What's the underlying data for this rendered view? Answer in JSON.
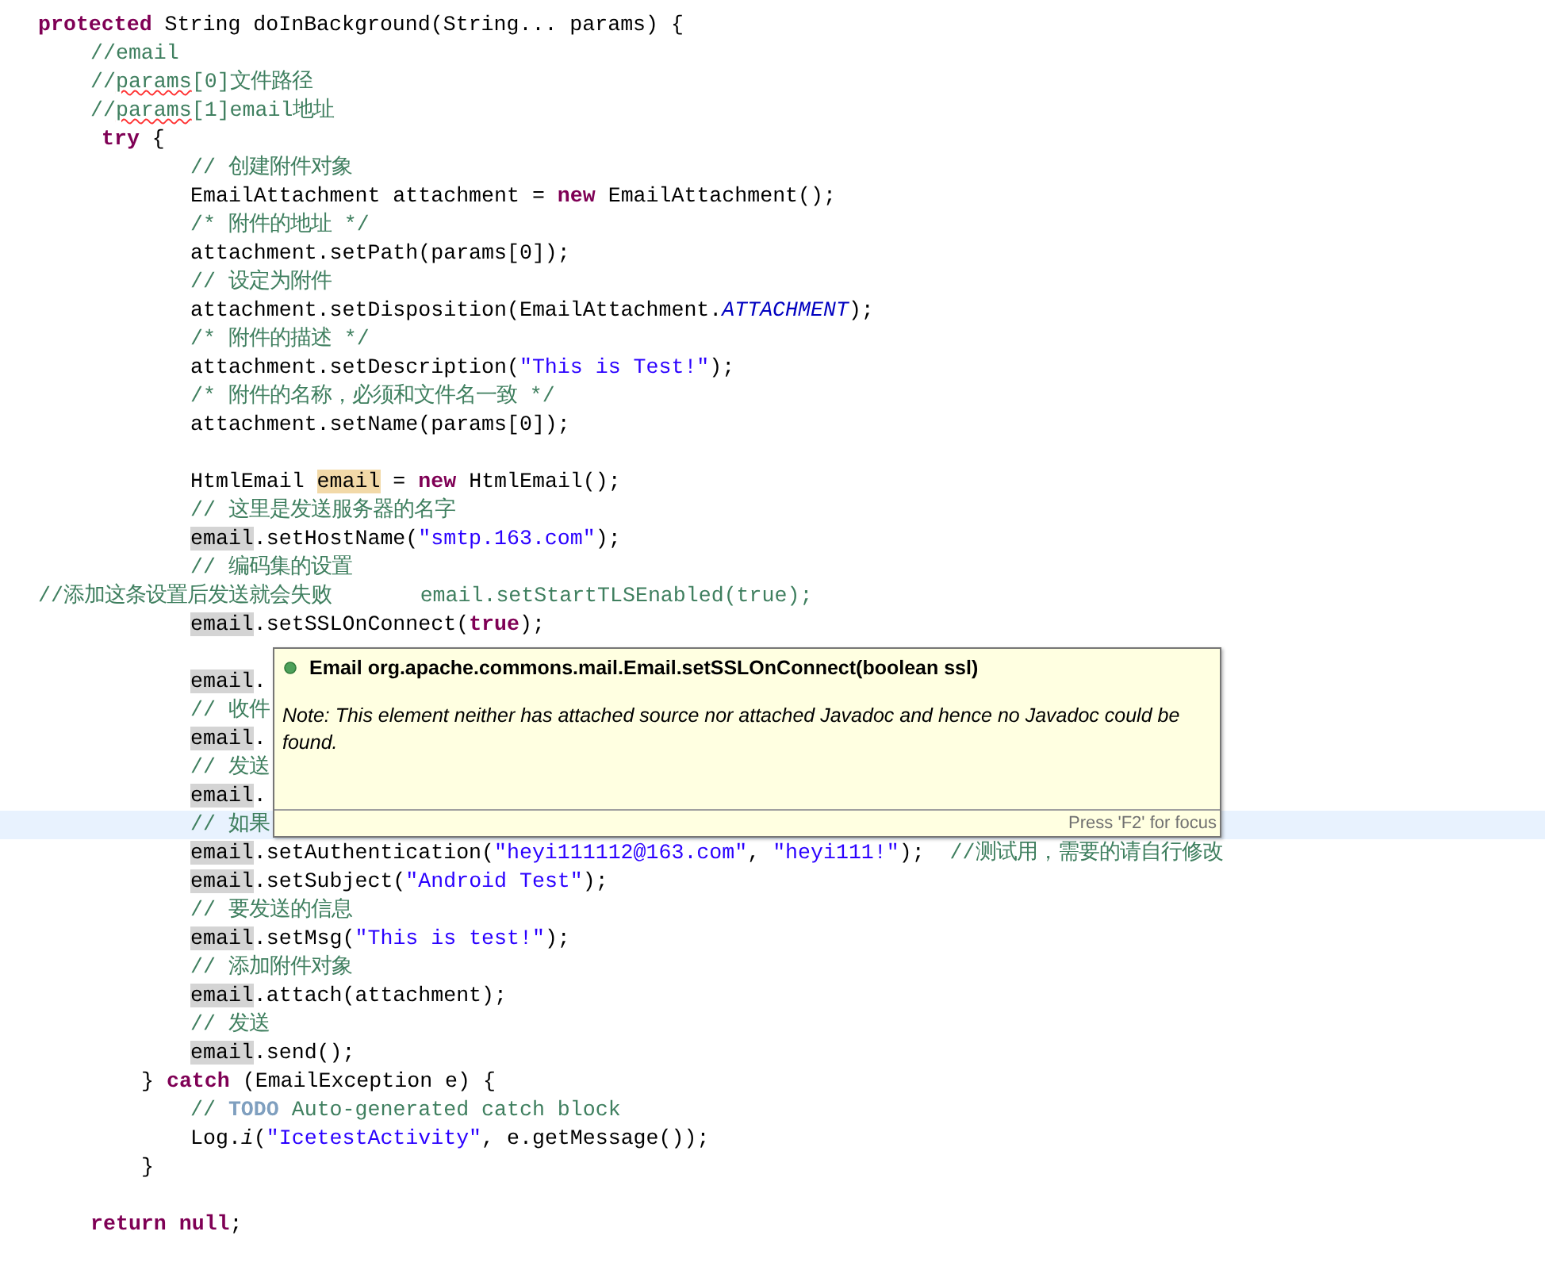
{
  "editor": {
    "lines": [
      {
        "kind": "margin",
        "current": false,
        "tokens": [
          {
            "kind": "keyword",
            "text": "protected"
          },
          {
            "kind": "plain",
            "text": " String doInBackground(String... params) {"
          }
        ]
      },
      {
        "kind": "inner",
        "current": false,
        "tokens": [
          {
            "kind": "comment",
            "text": "//email"
          }
        ]
      },
      {
        "kind": "inner",
        "current": false,
        "tokens": [
          {
            "kind": "comment",
            "text": "//"
          },
          {
            "kind": "misspelled",
            "text": "params"
          },
          {
            "kind": "comment",
            "text": "[0]文件路径"
          }
        ]
      },
      {
        "kind": "inner",
        "current": false,
        "tokens": [
          {
            "kind": "comment",
            "text": "//"
          },
          {
            "kind": "misspelled",
            "text": "params"
          },
          {
            "kind": "comment",
            "text": "[1]email地址"
          }
        ]
      },
      {
        "kind": "try",
        "current": false,
        "tokens": [
          {
            "kind": "keyword",
            "text": "try"
          },
          {
            "kind": "plain",
            "text": " {"
          }
        ]
      },
      {
        "kind": "body",
        "current": false,
        "tokens": [
          {
            "kind": "comment",
            "text": "// 创建附件对象"
          }
        ]
      },
      {
        "kind": "body",
        "current": false,
        "tokens": [
          {
            "kind": "plain",
            "text": "EmailAttachment attachment = "
          },
          {
            "kind": "keyword",
            "text": "new"
          },
          {
            "kind": "plain",
            "text": " EmailAttachment();"
          }
        ]
      },
      {
        "kind": "body",
        "current": false,
        "tokens": [
          {
            "kind": "comment",
            "text": "/* 附件的地址 */"
          }
        ]
      },
      {
        "kind": "body",
        "current": false,
        "tokens": [
          {
            "kind": "plain",
            "text": "attachment.setPath(params[0]);"
          }
        ]
      },
      {
        "kind": "body",
        "current": false,
        "tokens": [
          {
            "kind": "comment",
            "text": "// 设定为附件"
          }
        ]
      },
      {
        "kind": "body",
        "current": false,
        "tokens": [
          {
            "kind": "plain",
            "text": "attachment.setDisposition(EmailAttachment."
          },
          {
            "kind": "constant",
            "text": "ATTACHMENT"
          },
          {
            "kind": "plain",
            "text": ");"
          }
        ]
      },
      {
        "kind": "body",
        "current": false,
        "tokens": [
          {
            "kind": "comment",
            "text": "/* 附件的描述 */"
          }
        ]
      },
      {
        "kind": "body",
        "current": false,
        "tokens": [
          {
            "kind": "plain",
            "text": "attachment.setDescription("
          },
          {
            "kind": "string",
            "text": "\"This is Test!\""
          },
          {
            "kind": "plain",
            "text": ");"
          }
        ]
      },
      {
        "kind": "body",
        "current": false,
        "tokens": [
          {
            "kind": "comment",
            "text": "/* 附件的名称，必须和文件名一致 */"
          }
        ]
      },
      {
        "kind": "body",
        "current": false,
        "tokens": [
          {
            "kind": "plain",
            "text": "attachment.setName(params[0]);"
          }
        ]
      },
      {
        "kind": "body",
        "current": false
      },
      {
        "kind": "body",
        "current": false,
        "tokens": [
          {
            "kind": "plain",
            "text": "HtmlEmail "
          },
          {
            "kind": "write_occurrence",
            "text": "email"
          },
          {
            "kind": "plain",
            "text": " = "
          },
          {
            "kind": "keyword",
            "text": "new"
          },
          {
            "kind": "plain",
            "text": " HtmlEmail();"
          }
        ]
      },
      {
        "kind": "body",
        "current": false,
        "tokens": [
          {
            "kind": "comment",
            "text": "// 这里是发送服务器的名字"
          }
        ]
      },
      {
        "kind": "body",
        "current": false,
        "tokens": [
          {
            "kind": "occurrence",
            "text": "email"
          },
          {
            "kind": "plain",
            "text": ".setHostName("
          },
          {
            "kind": "string",
            "text": "\"smtp.163.com\""
          },
          {
            "kind": "plain",
            "text": ");"
          }
        ]
      },
      {
        "kind": "body",
        "current": false,
        "tokens": [
          {
            "kind": "comment",
            "text": "// 编码集的设置"
          }
        ]
      },
      {
        "kind": "margin",
        "current": false,
        "tokens": [
          {
            "kind": "comment",
            "text": "//添加这条设置后发送就会失败       email.setStartTLSEnabled(true);"
          }
        ]
      },
      {
        "kind": "body",
        "current": false,
        "tokens": [
          {
            "kind": "occurrence",
            "text": "email"
          },
          {
            "kind": "plain",
            "text": ".setSSLOnConnect("
          },
          {
            "kind": "keyword",
            "text": "true"
          },
          {
            "kind": "plain",
            "text": ");"
          }
        ]
      },
      {
        "kind": "body",
        "current": false
      },
      {
        "kind": "body",
        "current": false,
        "tokens": [
          {
            "kind": "occurrence",
            "text": "email"
          },
          {
            "kind": "plain",
            "text": "."
          }
        ]
      },
      {
        "kind": "body",
        "current": false,
        "tokens": [
          {
            "kind": "comment",
            "text": "// 收件"
          }
        ]
      },
      {
        "kind": "body",
        "current": false,
        "tokens": [
          {
            "kind": "occurrence",
            "text": "email"
          },
          {
            "kind": "plain",
            "text": "."
          }
        ]
      },
      {
        "kind": "body",
        "current": false,
        "tokens": [
          {
            "kind": "comment",
            "text": "// 发送"
          }
        ]
      },
      {
        "kind": "body",
        "current": false,
        "tokens": [
          {
            "kind": "occurrence",
            "text": "email"
          },
          {
            "kind": "plain",
            "text": "."
          }
        ]
      },
      {
        "kind": "body",
        "current": true,
        "tokens": [
          {
            "kind": "comment",
            "text": "// 如果"
          }
        ]
      },
      {
        "kind": "body",
        "current": false,
        "tokens": [
          {
            "kind": "occurrence",
            "text": "email"
          },
          {
            "kind": "plain",
            "text": ".setAuthentication("
          },
          {
            "kind": "string",
            "text": "\"heyi111112@163.com\""
          },
          {
            "kind": "plain",
            "text": ", "
          },
          {
            "kind": "string",
            "text": "\"heyi111!\""
          },
          {
            "kind": "plain",
            "text": ");  "
          },
          {
            "kind": "comment",
            "text": "//测试用，需要的请自行修改"
          }
        ]
      },
      {
        "kind": "body",
        "current": false,
        "tokens": [
          {
            "kind": "occurrence",
            "text": "email"
          },
          {
            "kind": "plain",
            "text": ".setSubject("
          },
          {
            "kind": "string",
            "text": "\"Android Test\""
          },
          {
            "kind": "plain",
            "text": ");"
          }
        ]
      },
      {
        "kind": "body",
        "current": false,
        "tokens": [
          {
            "kind": "comment",
            "text": "// 要发送的信息"
          }
        ]
      },
      {
        "kind": "body",
        "current": false,
        "tokens": [
          {
            "kind": "occurrence",
            "text": "email"
          },
          {
            "kind": "plain",
            "text": ".setMsg("
          },
          {
            "kind": "string",
            "text": "\"This is test!\""
          },
          {
            "kind": "plain",
            "text": ");"
          }
        ]
      },
      {
        "kind": "body",
        "current": false,
        "tokens": [
          {
            "kind": "comment",
            "text": "// 添加附件对象"
          }
        ]
      },
      {
        "kind": "body",
        "current": false,
        "tokens": [
          {
            "kind": "occurrence",
            "text": "email"
          },
          {
            "kind": "plain",
            "text": ".attach(attachment);"
          }
        ]
      },
      {
        "kind": "body",
        "current": false,
        "tokens": [
          {
            "kind": "comment",
            "text": "// 发送"
          }
        ]
      },
      {
        "kind": "body",
        "current": false,
        "tokens": [
          {
            "kind": "occurrence",
            "text": "email"
          },
          {
            "kind": "plain",
            "text": ".send();"
          }
        ]
      },
      {
        "kind": "close",
        "current": false,
        "tokens": [
          {
            "kind": "plain",
            "text": "} "
          },
          {
            "kind": "keyword",
            "text": "catch"
          },
          {
            "kind": "plain",
            "text": " (EmailException e) {"
          }
        ]
      },
      {
        "kind": "body",
        "current": false,
        "tokens": [
          {
            "kind": "comment",
            "text": "// "
          },
          {
            "kind": "todo",
            "text": "TODO"
          },
          {
            "kind": "comment",
            "text": " Auto-generated catch block"
          }
        ]
      },
      {
        "kind": "body",
        "current": false,
        "tokens": [
          {
            "kind": "plain",
            "text": "Log."
          },
          {
            "kind": "static",
            "text": "i"
          },
          {
            "kind": "plain",
            "text": "("
          },
          {
            "kind": "string",
            "text": "\"IcetestActivity\""
          },
          {
            "kind": "plain",
            "text": ", e.getMessage());"
          }
        ]
      },
      {
        "kind": "close",
        "current": false,
        "tokens": [
          {
            "kind": "plain",
            "text": "}"
          }
        ]
      },
      {
        "kind": "body",
        "current": false
      },
      {
        "kind": "inner",
        "current": false,
        "tokens": [
          {
            "kind": "keyword",
            "text": "return null"
          },
          {
            "kind": "plain",
            "text": ";"
          }
        ]
      }
    ]
  },
  "hover": {
    "signature": "Email org.apache.commons.mail.Email.setSSLOnConnect(boolean ssl)",
    "note": "Note: This element neither has attached source nor attached Javadoc and hence no Javadoc could be found.",
    "hint": "Press 'F2' for focus"
  }
}
